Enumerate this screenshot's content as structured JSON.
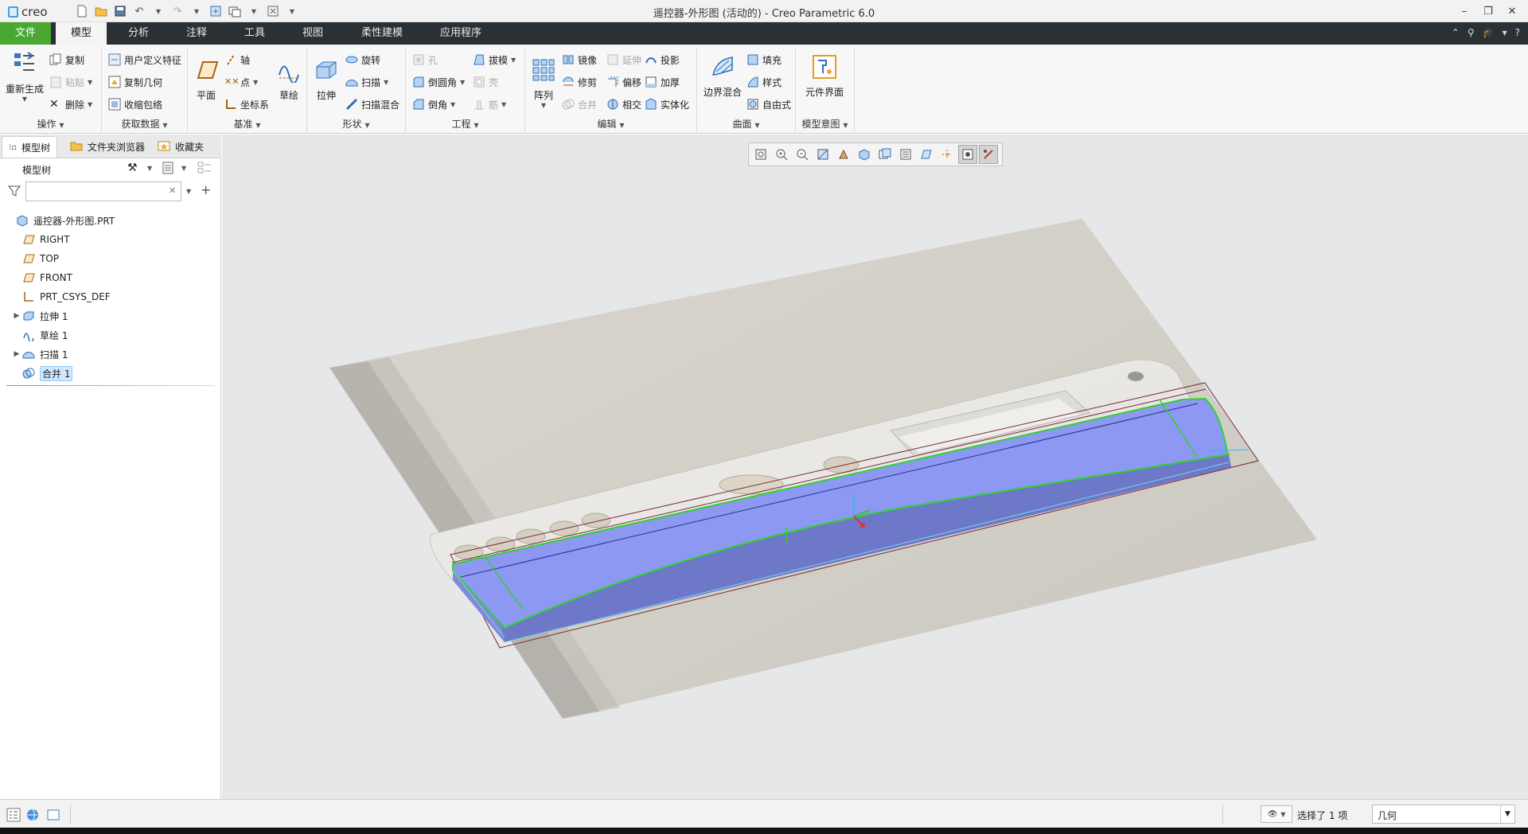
{
  "window": {
    "logo_text": "creo",
    "title": "遥控器-外形图 (活动的) - Creo Parametric 6.0"
  },
  "tabs": [
    {
      "label": "文件",
      "state": "file"
    },
    {
      "label": "模型",
      "state": "active"
    },
    {
      "label": "分析",
      "state": ""
    },
    {
      "label": "注释",
      "state": ""
    },
    {
      "label": "工具",
      "state": ""
    },
    {
      "label": "视图",
      "state": ""
    },
    {
      "label": "柔性建模",
      "state": ""
    },
    {
      "label": "应用程序",
      "state": ""
    }
  ],
  "ribbon": {
    "operations": {
      "label": "操作",
      "regenerate": "重新生成",
      "copy": "复制",
      "paste": "粘贴",
      "delete": "删除"
    },
    "get_data": {
      "label": "获取数据",
      "udf": "用户定义特征",
      "copy_geometry": "复制几何",
      "shrinkwrap": "收缩包络"
    },
    "datum": {
      "label": "基准",
      "plane": "平面",
      "axis": "轴",
      "point": "点",
      "csys": "坐标系",
      "sketch": "草绘"
    },
    "shapes": {
      "label": "形状",
      "extrude": "拉伸",
      "revolve": "旋转",
      "sweep": "扫描",
      "swept_blend": "扫描混合"
    },
    "engineering": {
      "label": "工程",
      "hole": "孔",
      "round": "倒圆角",
      "chamfer": "倒角",
      "draft": "拔模",
      "shell": "壳",
      "rib": "筋"
    },
    "editing": {
      "label": "编辑",
      "pattern": "阵列",
      "mirror": "镜像",
      "trim": "修剪",
      "merge": "合并",
      "extend": "延伸",
      "offset": "偏移",
      "intersect": "相交",
      "project": "投影",
      "thicken": "加厚",
      "solidify": "实体化"
    },
    "surfaces": {
      "label": "曲面",
      "boundary_blend": "边界混合",
      "fill": "填充",
      "style": "样式",
      "freestyle": "自由式"
    },
    "model_intent": {
      "label": "模型意图",
      "component_interface": "元件界面"
    }
  },
  "panel": {
    "tabs": [
      "模型树",
      "文件夹浏览器",
      "收藏夹"
    ],
    "tree_header": "模型树",
    "search_value": "",
    "tree": [
      {
        "label": "遥控器-外形图.PRT",
        "icon": "part-icon",
        "expandable": false,
        "indent": 0
      },
      {
        "label": "RIGHT",
        "icon": "datum-plane-icon",
        "expandable": false,
        "indent": 1
      },
      {
        "label": "TOP",
        "icon": "datum-plane-icon",
        "expandable": false,
        "indent": 1
      },
      {
        "label": "FRONT",
        "icon": "datum-plane-icon",
        "expandable": false,
        "indent": 1
      },
      {
        "label": "PRT_CSYS_DEF",
        "icon": "csys-icon",
        "expandable": false,
        "indent": 1
      },
      {
        "label": "拉伸 1",
        "icon": "extrude-icon",
        "expandable": true,
        "indent": 1
      },
      {
        "label": "草绘 1",
        "icon": "sketch-icon",
        "expandable": false,
        "indent": 1
      },
      {
        "label": "扫描 1",
        "icon": "sweep-icon",
        "expandable": true,
        "indent": 1
      },
      {
        "label": "合并 1",
        "icon": "merge-icon",
        "expandable": false,
        "indent": 1,
        "selected": true
      }
    ]
  },
  "viewport_toolbar": [
    "refit-icon",
    "zoom-in-icon",
    "zoom-out-icon",
    "repaint-icon",
    "perspective-icon",
    "display-style-icon",
    "saved-views-icon",
    "view-manager-icon",
    "datum-display-icon",
    "spin-center-icon",
    "annotation-display-icon",
    "section-icon"
  ],
  "status": {
    "message": "选择了 1 项",
    "filter_value": "几何"
  },
  "colors": {
    "file_tab": "#4aa832",
    "tab_bar": "#2b3035",
    "surface_fill": "#8c98f2",
    "edge_highlight": "#2fd32f"
  }
}
